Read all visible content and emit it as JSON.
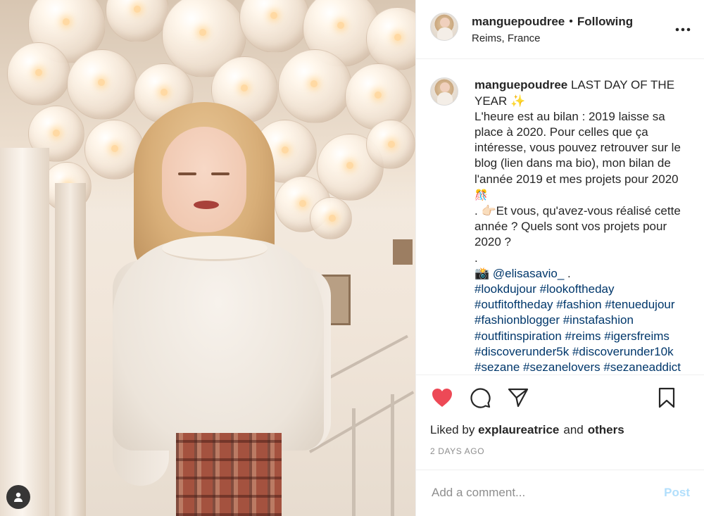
{
  "header": {
    "username": "manguepoudree",
    "separator": "•",
    "follow_status": "Following",
    "location": "Reims, France",
    "more_label": "•••"
  },
  "caption": {
    "username": "manguepoudree",
    "line1": " LAST DAY OF THE YEAR ✨",
    "line2": "\nL'heure est au bilan : 2019 laisse sa place à 2020. Pour celles que ça intéresse, vous pouvez retrouver sur le blog (lien dans ma bio), mon bilan de l'année 2019 et mes projets pour 2020 ",
    "gift": "🎊",
    "line3": "\n. 👉🏻Et vous, qu'avez-vous réalisé cette année ? Quels sont vos projets pour 2020 ?\n.\n",
    "camera": "📸",
    "mention": "@elisasavio_",
    "after_mention": " .\n",
    "hashtags": [
      "#lookdujour",
      "#lookoftheday",
      "#outfitoftheday",
      "#fashion",
      "#tenuedujour",
      "#fashionblogger",
      "#instafashion",
      "#outfitinspiration",
      "#reims",
      "#igersfreims",
      "#discoverunder5k",
      "#discoverunder10k",
      "#sezane",
      "#sezanelovers",
      "#sezaneaddict"
    ]
  },
  "actions": {
    "like_icon": "heart-filled",
    "comment_icon": "speech-bubble",
    "share_icon": "paper-plane",
    "save_icon": "bookmark",
    "like_color": "#ed4956"
  },
  "likes": {
    "prefix": "Liked by",
    "user": "explaureatrice",
    "and": "and",
    "others": "others"
  },
  "timestamp": "2 DAYS AGO",
  "comment_box": {
    "placeholder": "Add a comment...",
    "post_label": "Post"
  },
  "colors": {
    "link": "#00376b",
    "muted": "#8e8e8e",
    "post_disabled": "#b2dffc",
    "text": "#262626"
  }
}
